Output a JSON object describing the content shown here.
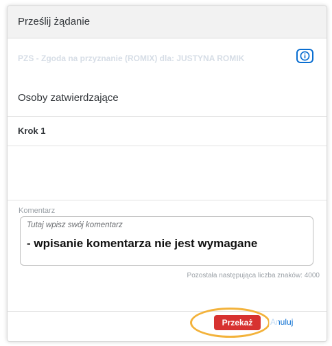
{
  "dialog": {
    "title": "Prześlij żądanie",
    "subtitle": "PZS - Zgoda na przyznanie (ROMIX) dla: JUSTYNA ROMIK",
    "info_icon": "info-icon",
    "approvers_title": "Osoby zatwierdzające",
    "step_label": "Krok 1",
    "comment": {
      "label": "Komentarz",
      "placeholder": "Tutaj wpisz swój komentarz",
      "note": "- wpisanie komentarza nie jest wymagane",
      "remaining": "Pozostała następująca liczba znaków: 4000"
    },
    "footer": {
      "submit_label": "Przekaż",
      "cancel_label": "Anuluj"
    }
  },
  "colors": {
    "accent": "#0a6ed1",
    "submit": "#d73230",
    "highlight": "#f3b23a",
    "header_bg": "#f2f2f2"
  }
}
